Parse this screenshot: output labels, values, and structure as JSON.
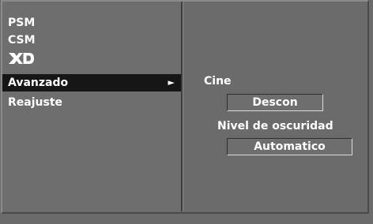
{
  "menu": {
    "items": [
      {
        "label": "PSM"
      },
      {
        "label": "CSM"
      },
      {
        "label": "XD",
        "icon": "xd-logo-icon"
      },
      {
        "label": "Avanzado",
        "selected": true,
        "arrow": "►"
      },
      {
        "label": "Reajuste"
      }
    ]
  },
  "settings": {
    "cine_label": "Cine",
    "cine_value": "Descon",
    "black_level_label": "Nivel de oscuridad",
    "black_level_value": "Automatico"
  },
  "colors": {
    "background": "#6b6b6b",
    "selected_item": "#161616",
    "text": "#ffffff"
  }
}
